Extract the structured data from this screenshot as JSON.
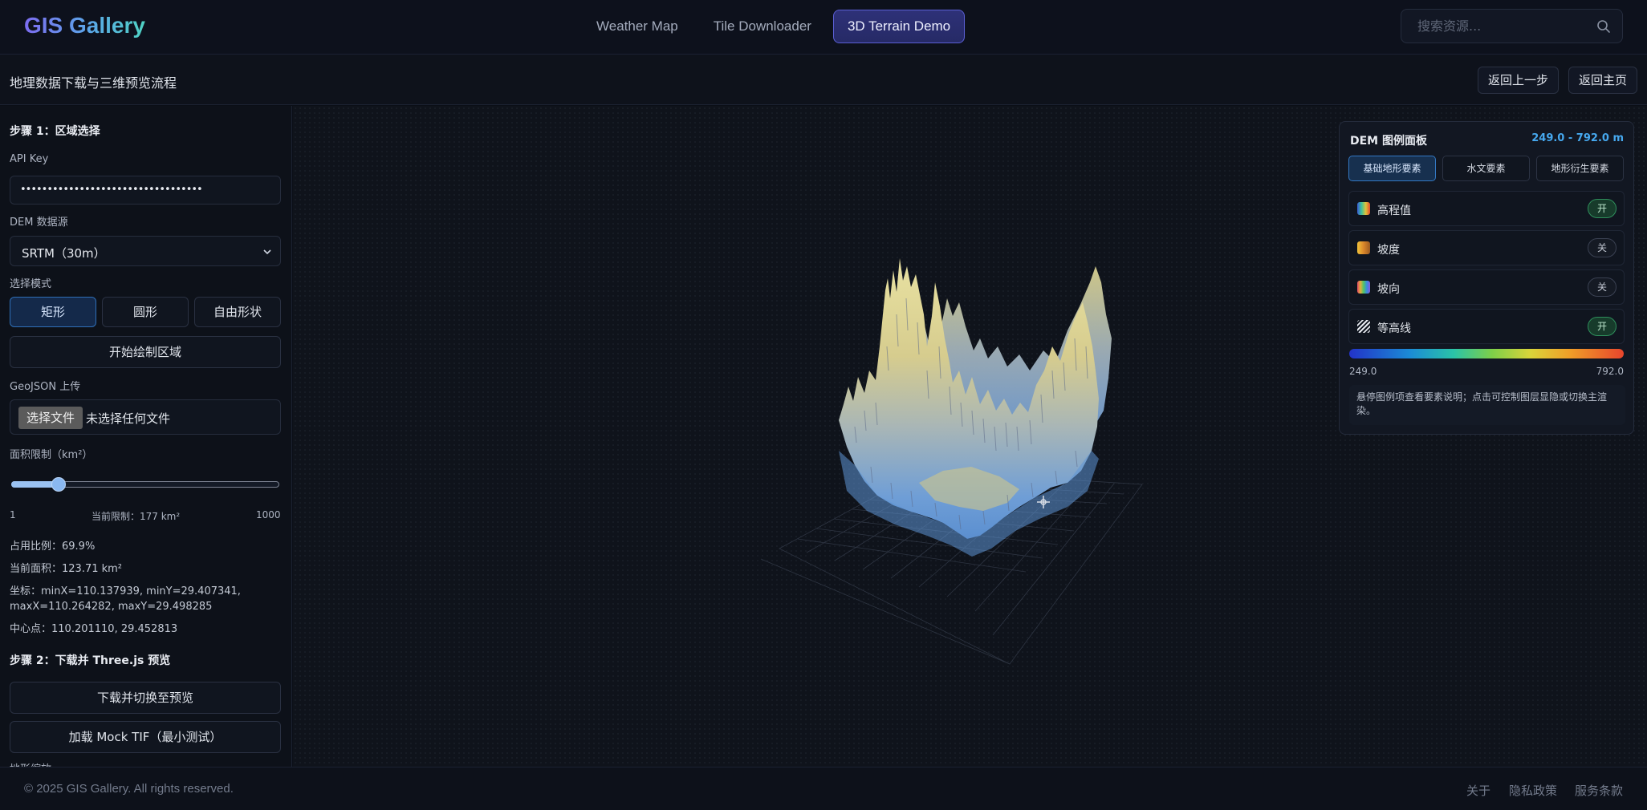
{
  "app": {
    "logo": "GIS Gallery"
  },
  "nav": {
    "tabs": [
      {
        "label": "Weather Map",
        "active": false
      },
      {
        "label": "Tile Downloader",
        "active": false
      },
      {
        "label": "3D Terrain Demo",
        "active": true
      }
    ],
    "search_placeholder": "搜索资源..."
  },
  "header": {
    "title": "地理数据下载与三维预览流程",
    "back_step_label": "返回上一步",
    "back_home_label": "返回主页"
  },
  "step1": {
    "title": "步骤 1：区域选择",
    "api_key_label": "API Key",
    "api_key_value": "••••••••••••••••••••••••••••••••••",
    "dem_source_label": "DEM 数据源",
    "dem_source_value": "SRTM（30m）",
    "mode_label": "选择模式",
    "modes": [
      "矩形",
      "圆形",
      "自由形状"
    ],
    "active_mode": 0,
    "draw_button": "开始绘制区域",
    "geojson_label": "GeoJSON 上传",
    "file_button": "选择文件",
    "file_status": "未选择任何文件",
    "area_limit_label": "面积限制（km²）",
    "slider": {
      "min": 1,
      "max": 1000,
      "value": 177
    },
    "slider_min_label": "1",
    "slider_current_label": "当前限制：177 km²",
    "slider_max_label": "1000",
    "usage_ratio": "占用比例：69.9%",
    "current_area": "当前面积：123.71 km²",
    "coords_line1": "坐标：minX=110.137939, minY=29.407341,",
    "coords_line2": "maxX=110.264282, maxY=29.498285",
    "center": "中心点：110.201110, 29.452813"
  },
  "step2": {
    "title": "步骤 2：下载并 Three.js 预览",
    "download_button": "下载并切换至预览",
    "mock_button": "加载 Mock TIF（最小测试）",
    "cut_label": "地形缩放"
  },
  "dem_panel": {
    "title": "DEM 图例面板",
    "range": "249.0 - 792.0 m",
    "tabs": [
      "基础地形要素",
      "水文要素",
      "地形衍生要素"
    ],
    "active_tab": 0,
    "layers": [
      {
        "name": "高程值",
        "state": "开",
        "on": true,
        "swatch": "rainbow"
      },
      {
        "name": "坡度",
        "state": "关",
        "on": false,
        "swatch": "orange"
      },
      {
        "name": "坡向",
        "state": "关",
        "on": false,
        "swatch": "multicolor"
      },
      {
        "name": "等高线",
        "state": "开",
        "on": true,
        "swatch": "hatched"
      }
    ],
    "color_min": "249.0",
    "color_max": "792.0",
    "note": "悬停图例项查看要素说明；点击可控制图层显隐或切换主渲染。"
  },
  "footer": {
    "copyright": "© 2025 GIS Gallery. All rights reserved.",
    "links": [
      "关于",
      "隐私政策",
      "服务条款"
    ]
  },
  "colors": {
    "accent": "#46a8ee",
    "active_tab": "#5a5fd4",
    "on_pill": "#2f8f5c"
  }
}
